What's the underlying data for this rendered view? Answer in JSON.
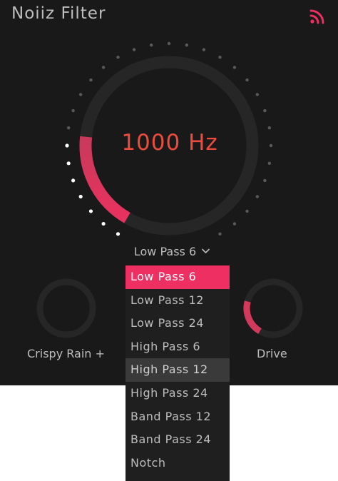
{
  "app": {
    "title": "Noiiz Filter"
  },
  "icons": {
    "feed": "rss-icon",
    "dropdown": "chevron-down-icon"
  },
  "colors": {
    "accent": "#ee2f62",
    "frequency_text": "#ec4c3c",
    "panel_background": "#191919",
    "label_text": "#bdbdbd",
    "track": "#262626"
  },
  "main_knob": {
    "frequency_label": "1000 Hz",
    "level": 0.22
  },
  "filter_select": {
    "selected_label": "Low Pass 6",
    "options": [
      "Low Pass 6",
      "Low Pass 12",
      "Low Pass 24",
      "High Pass 6",
      "High Pass 12",
      "High Pass 24",
      "Band Pass 12",
      "Band Pass 24",
      "Notch"
    ],
    "selected_index": 0,
    "hovered_index": 4
  },
  "left_knob": {
    "label": "Crispy Rain +",
    "level": 0
  },
  "right_knob": {
    "label": "Drive",
    "level": 0.25
  }
}
